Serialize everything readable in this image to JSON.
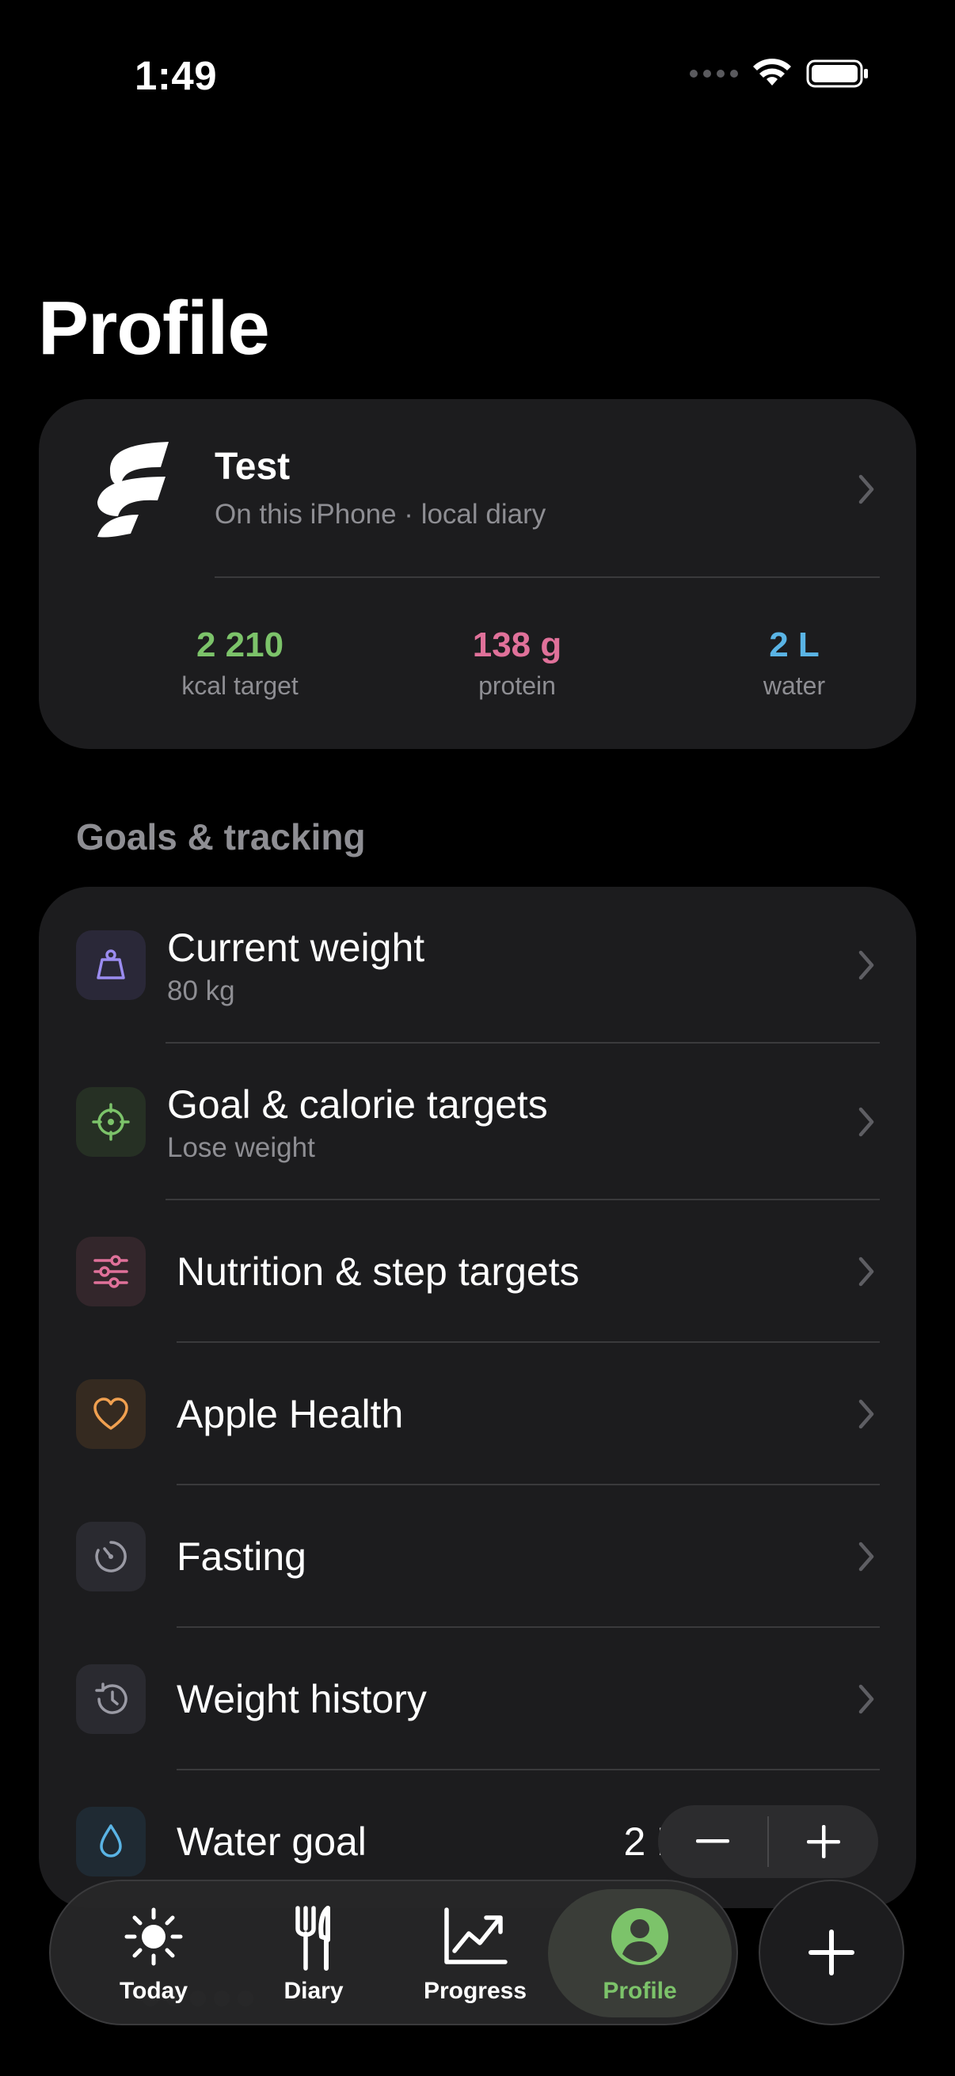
{
  "status_bar": {
    "time": "1:49"
  },
  "page": {
    "title": "Profile"
  },
  "profile": {
    "name": "Test",
    "subtitle": "On this iPhone · local diary",
    "stats": [
      {
        "value": "2 210",
        "label": "kcal target",
        "color": "#7cc36a"
      },
      {
        "value": "138 g",
        "label": "protein",
        "color": "#e0719a"
      },
      {
        "value": "2 L",
        "label": "water",
        "color": "#5ab4e5"
      }
    ]
  },
  "goals": {
    "section_title": "Goals & tracking",
    "items": [
      {
        "label": "Current weight",
        "sublabel": "80 kg",
        "icon": "weight-icon",
        "icon_color": "#9b8cf0"
      },
      {
        "label": "Goal & calorie targets",
        "sublabel": "Lose weight",
        "icon": "target-icon",
        "icon_color": "#7cc36a"
      },
      {
        "label": "Nutrition & step targets",
        "icon": "sliders-icon",
        "icon_color": "#e0719a"
      },
      {
        "label": "Apple Health",
        "icon": "heart-icon",
        "icon_color": "#f0a050"
      },
      {
        "label": "Fasting",
        "icon": "timer-icon",
        "icon_color": "#9a9aa4"
      },
      {
        "label": "Weight history",
        "icon": "history-icon",
        "icon_color": "#9a9aa4"
      },
      {
        "label": "Water goal",
        "value": "2 L",
        "icon": "drop-icon",
        "icon_color": "#5ab4e5"
      }
    ]
  },
  "tabbar": {
    "tabs": [
      {
        "label": "Today",
        "icon": "sun-icon"
      },
      {
        "label": "Diary",
        "icon": "fork-knife-icon"
      },
      {
        "label": "Progress",
        "icon": "chart-up-icon"
      },
      {
        "label": "Profile",
        "icon": "person-icon",
        "active": true
      }
    ],
    "active_color": "#7cc36a"
  }
}
